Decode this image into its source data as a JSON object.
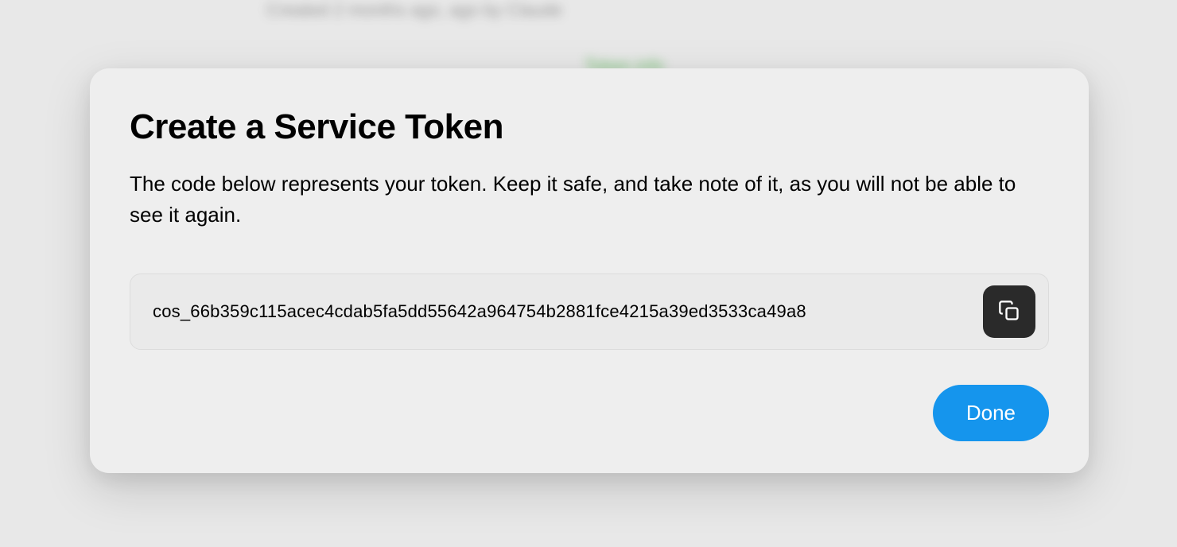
{
  "modal": {
    "title": "Create a Service Token",
    "description": "The code below represents your token. Keep it safe, and take note of it, as you will not be able to see it again.",
    "token": "cos_66b359c115acec4cdab5fa5dd55642a964754b2881fce4215a39ed3533ca49a8",
    "done_label": "Done"
  }
}
